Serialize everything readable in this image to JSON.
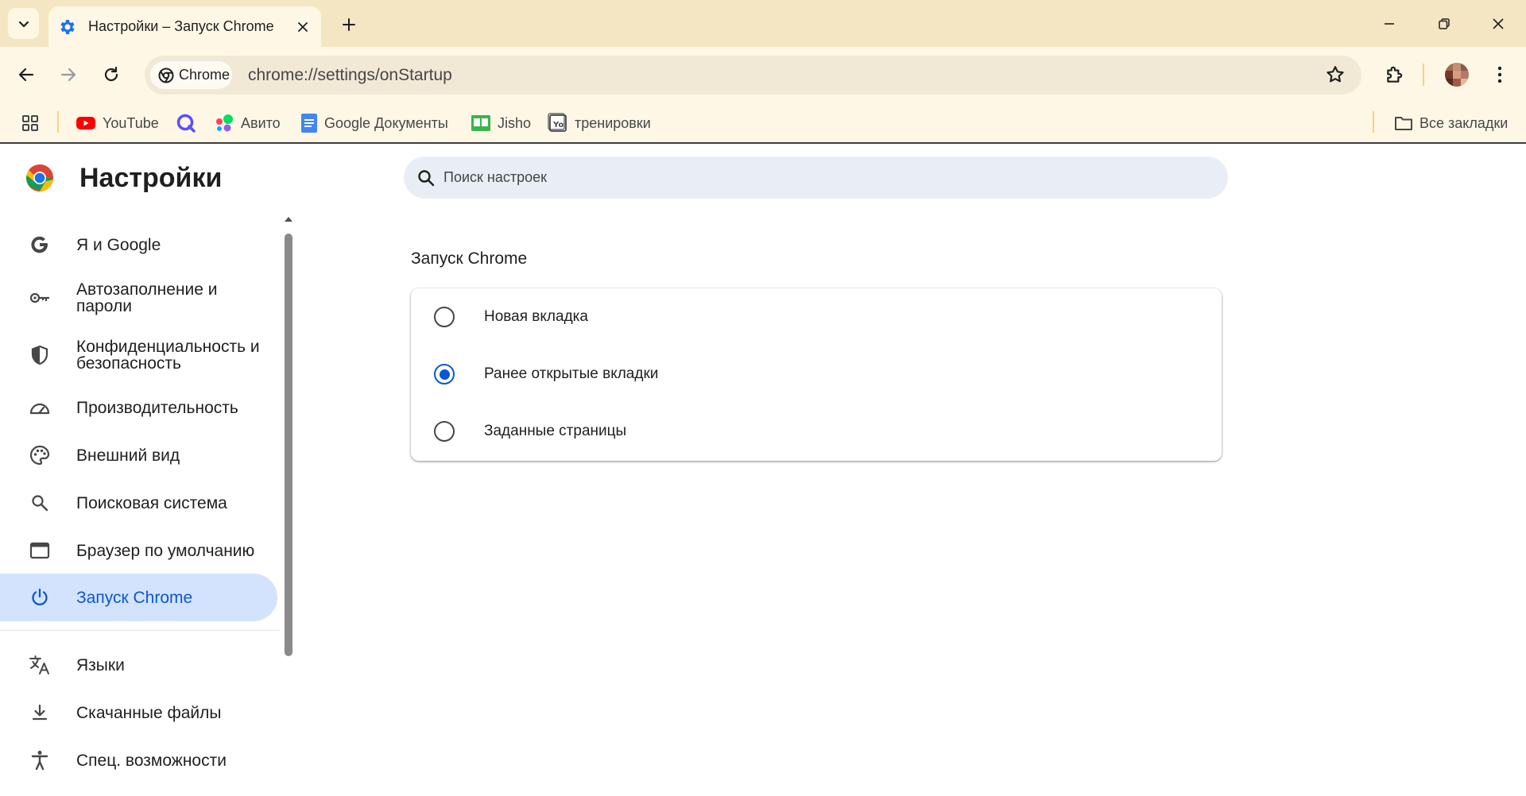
{
  "colors": {
    "accent": "#0b57d0",
    "tabstrip": "#f5e6c3",
    "active_nav_bg": "#d3e3fd",
    "search_bg": "#e9eef6"
  },
  "tab": {
    "title": "Настройки – Запуск Chrome",
    "icon": "gear-icon"
  },
  "toolbar": {
    "chip_label": "Chrome",
    "url": "chrome://settings/onStartup"
  },
  "bookmarks": {
    "items": [
      {
        "label": "YouTube",
        "icon": "youtube-icon"
      },
      {
        "label": "",
        "icon": "q-icon"
      },
      {
        "label": "Авито",
        "icon": "avito-icon"
      },
      {
        "label": "Google Документы",
        "icon": "docs-icon"
      },
      {
        "label": "Jisho",
        "icon": "jisho-icon"
      },
      {
        "label": "тренировки",
        "icon": "yo-icon"
      }
    ],
    "all_bookmarks": "Все закладки"
  },
  "settings": {
    "title": "Настройки",
    "search_placeholder": "Поиск настроек",
    "nav": [
      {
        "label": "Я и Google",
        "icon": "google-icon"
      },
      {
        "label": "Автозаполнение и пароли",
        "icon": "key-icon"
      },
      {
        "label": "Конфиденциальность и безопасность",
        "icon": "shield-icon"
      },
      {
        "label": "Производительность",
        "icon": "speedometer-icon"
      },
      {
        "label": "Внешний вид",
        "icon": "palette-icon"
      },
      {
        "label": "Поисковая система",
        "icon": "search-icon"
      },
      {
        "label": "Браузер по умолчанию",
        "icon": "browser-window-icon"
      },
      {
        "label": "Запуск Chrome",
        "icon": "power-icon",
        "active": true
      },
      {
        "label": "Языки",
        "icon": "translate-icon"
      },
      {
        "label": "Скачанные файлы",
        "icon": "download-icon"
      },
      {
        "label": "Спец. возможности",
        "icon": "accessibility-icon"
      }
    ],
    "section_title": "Запуск Chrome",
    "startup_options": [
      {
        "label": "Новая вкладка",
        "checked": false
      },
      {
        "label": "Ранее открытые вкладки",
        "checked": true
      },
      {
        "label": "Заданные страницы",
        "checked": false
      }
    ]
  }
}
